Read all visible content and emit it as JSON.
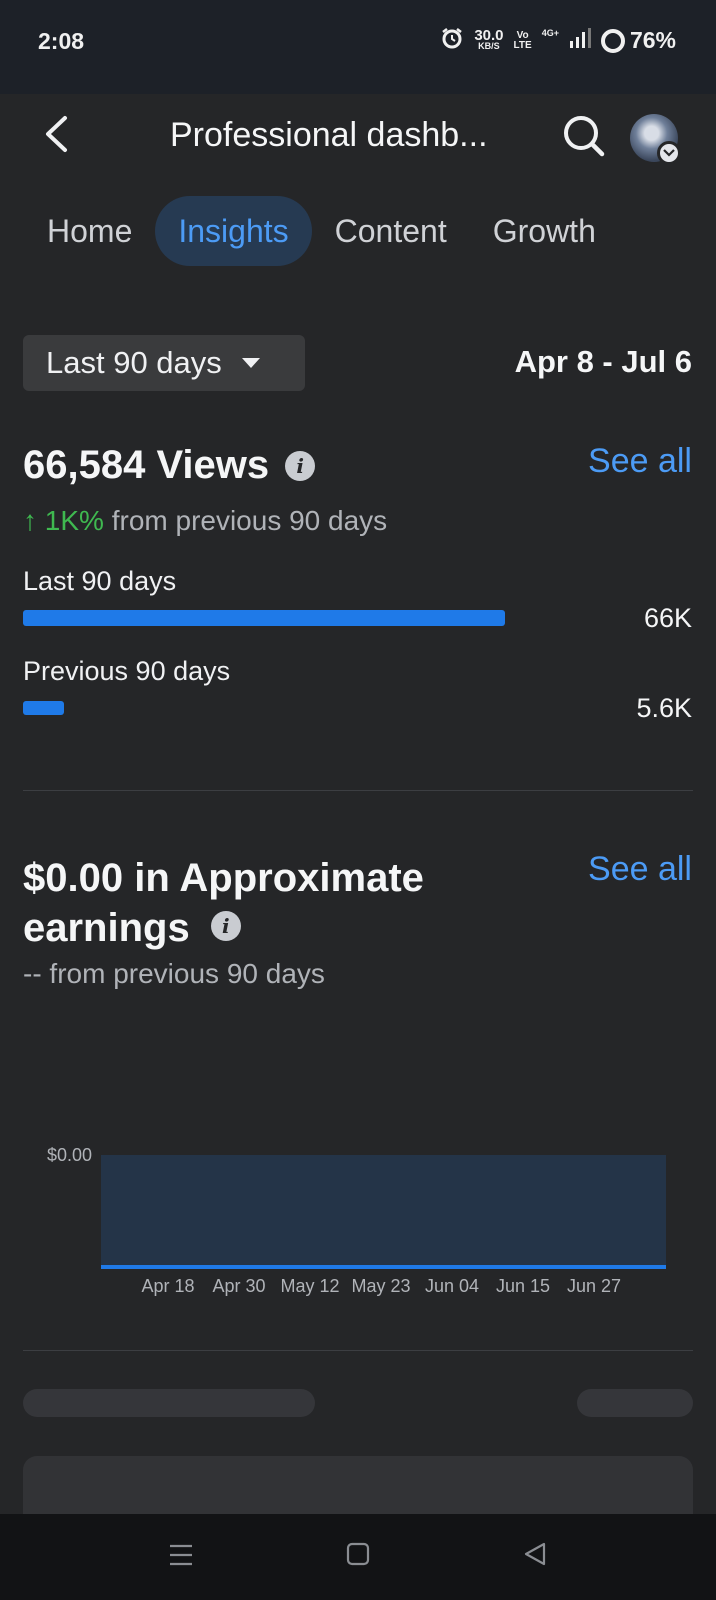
{
  "status_bar": {
    "time": "2:08",
    "speed_value": "30.0",
    "speed_unit": "KB/S",
    "volte_top": "Vo",
    "volte_bottom": "LTE",
    "network": "4G+",
    "battery": "76%"
  },
  "header": {
    "title": "Professional dashb...",
    "back_icon": "back-arrow-icon",
    "search_icon": "search-icon"
  },
  "tabs": [
    {
      "label": "Home",
      "active": false
    },
    {
      "label": "Insights",
      "active": true
    },
    {
      "label": "Content",
      "active": false
    },
    {
      "label": "Growth",
      "active": false
    }
  ],
  "period": {
    "selected": "Last 90 days",
    "date_range": "Apr 8 - Jul 6"
  },
  "views": {
    "title": "66,584 Views",
    "see_all": "See all",
    "change_value": "↑ 1K%",
    "change_text": " from previous 90 days",
    "bars": [
      {
        "label": "Last 90 days",
        "value_text": "66K",
        "value": 66000
      },
      {
        "label": "Previous 90 days",
        "value_text": "5.6K",
        "value": 5600
      }
    ],
    "colors": {
      "bar": "#1f7ae8",
      "up": "#3fb950",
      "link": "#4c9bf5"
    }
  },
  "earnings": {
    "title": "$0.00 in Approximate earnings",
    "see_all": "See all",
    "change_text": "-- from previous 90 days"
  },
  "chart_data": {
    "type": "area",
    "x": [
      "Apr 18",
      "Apr 30",
      "May 12",
      "May 23",
      "Jun 04",
      "Jun 15",
      "Jun 27"
    ],
    "y_tick_labels": [
      "$0.00"
    ],
    "series": [
      {
        "values": [
          0,
          0,
          0,
          0,
          0,
          0,
          0
        ]
      }
    ],
    "title": "",
    "xlabel": "",
    "ylabel": "",
    "colors": {
      "line": "#1f7ae8",
      "fill": "#243448"
    }
  }
}
